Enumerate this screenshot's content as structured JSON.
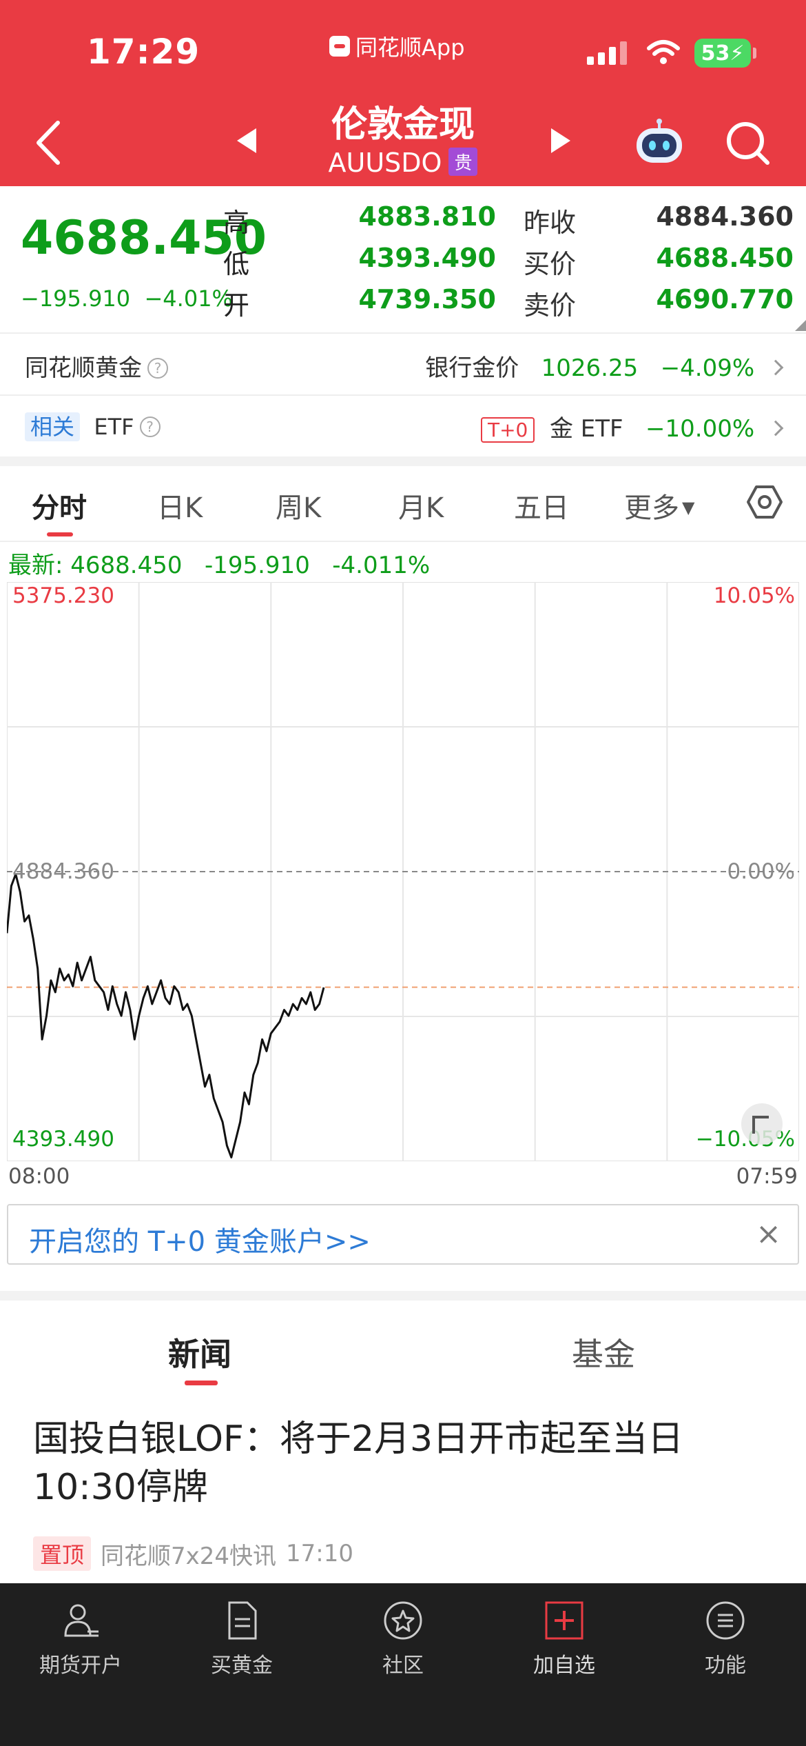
{
  "status_bar": {
    "time": "17:29",
    "app_label": "同花顺App",
    "battery": "53"
  },
  "header": {
    "title": "伦敦金现",
    "code": "AUUSDO",
    "badge": "贵"
  },
  "quote": {
    "price": "4688.450",
    "change": "−195.910",
    "change_pct": "−4.01%",
    "high_label": "高",
    "high": "4883.810",
    "low_label": "低",
    "low": "4393.490",
    "open_label": "开",
    "open": "4739.350",
    "prev_close_label": "昨收",
    "prev_close": "4884.360",
    "bid_label": "买价",
    "bid": "4688.450",
    "ask_label": "卖价",
    "ask": "4690.770"
  },
  "gold_row": {
    "label": "同花顺黄金",
    "bank_label": "银行金价",
    "bank_value": "1026.25",
    "bank_pct": "−4.09%"
  },
  "etf_row": {
    "tag": "相关",
    "label": "ETF",
    "t0_tag": "T+0",
    "etf_label": "金 ETF",
    "etf_pct": "−10.00%"
  },
  "tabs": [
    "分时",
    "日K",
    "周K",
    "月K",
    "五日",
    "更多"
  ],
  "latest": {
    "label": "最新:",
    "price": "4688.450",
    "change": "-195.910",
    "pct": "-4.011%"
  },
  "chart_data": {
    "type": "line",
    "ymax_label": "5375.230",
    "ymin_label": "4393.490",
    "ref_label": "4884.360",
    "pct_top": "10.05%",
    "pct_mid": "0.00%",
    "pct_bottom": "−10.05%",
    "x_start": "08:00",
    "x_end": "07:59",
    "ylim": [
      4393.49,
      5375.23
    ],
    "reference": 4884.36,
    "current": 4688.45,
    "series": [
      {
        "values": [
          4780,
          4860,
          4880,
          4850,
          4800,
          4810,
          4770,
          4720,
          4600,
          4640,
          4700,
          4680,
          4720,
          4700,
          4710,
          4690,
          4730,
          4700,
          4720,
          4740,
          4700,
          4690,
          4680,
          4650,
          4690,
          4660,
          4640,
          4680,
          4650,
          4600,
          4640,
          4670,
          4690,
          4660,
          4680,
          4700,
          4670,
          4660,
          4690,
          4680,
          4650,
          4660,
          4640,
          4600,
          4560,
          4520,
          4540,
          4500,
          4480,
          4460,
          4420,
          4400,
          4430,
          4460,
          4510,
          4490,
          4540,
          4560,
          4600,
          4580,
          4610,
          4620,
          4630,
          4650,
          4640,
          4660,
          4650,
          4670,
          4660,
          4680,
          4650,
          4660,
          4688
        ]
      }
    ]
  },
  "promo": {
    "text": "开启您的 T+0 黄金账户>>",
    "close": "×"
  },
  "news_tabs": [
    "新闻",
    "基金"
  ],
  "news": {
    "title": "国投白银LOF：将于2月3日开市起至当日10:30停牌",
    "pin": "置顶",
    "source": "同花顺7x24快讯",
    "time": "17:10"
  },
  "bottom_nav": [
    "期货开户",
    "买黄金",
    "社区",
    "加自选",
    "功能"
  ],
  "colors": {
    "brand_red": "#e93b43",
    "down_green": "#0e9d1a",
    "up_red": "#e93b43"
  }
}
